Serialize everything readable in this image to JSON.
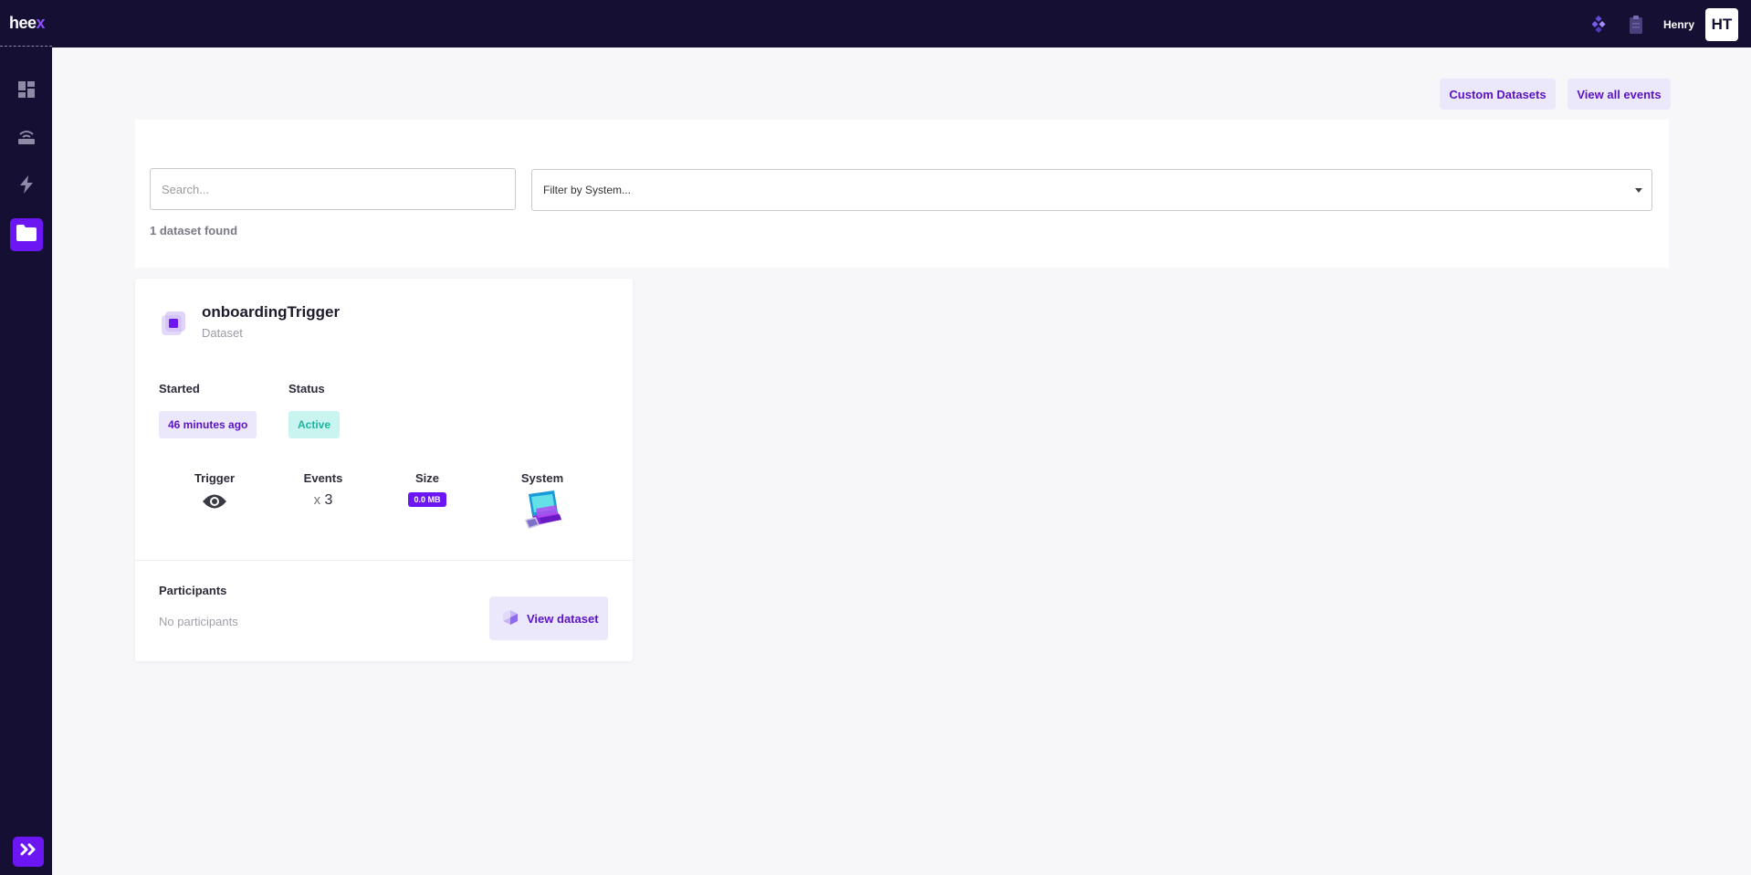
{
  "app": {
    "logo_main": "hee",
    "logo_accent": "x"
  },
  "topbar": {
    "user_name": "Henry",
    "user_initials": "HT",
    "icons": [
      "diamonds-icon",
      "clipboard-icon"
    ]
  },
  "sidebar": {
    "items": [
      {
        "icon": "dashboard-icon"
      },
      {
        "icon": "router-icon"
      },
      {
        "icon": "lightning-icon"
      },
      {
        "icon": "folder-icon",
        "active": true
      }
    ],
    "expand_icon": "double-chevron-right-icon"
  },
  "header_buttons": {
    "custom_datasets": "Custom Datasets",
    "view_all_events": "View all events"
  },
  "filters": {
    "search_placeholder": "Search...",
    "system_placeholder": "Filter by System...",
    "found_count": "1 dataset found"
  },
  "dataset_card": {
    "title": "onboardingTrigger",
    "type": "Dataset",
    "started_label": "Started",
    "started_value": "46 minutes ago",
    "status_label": "Status",
    "status_value": "Active",
    "trigger_label": "Trigger",
    "trigger_icon": "eye-icon",
    "events_label": "Events",
    "events_prefix": "x",
    "events_value": "3",
    "size_label": "Size",
    "size_value": "0.0 MB",
    "system_label": "System",
    "system_icon": "computer-illustration",
    "participants_label": "Participants",
    "participants_value": "No participants",
    "view_button": "View dataset"
  },
  "colors": {
    "nav_bg": "#150f33",
    "accent": "#6c16f4",
    "accent_soft": "#ece8fb",
    "status_bg": "#c9f4ef",
    "status_text": "#1bb5a0"
  }
}
